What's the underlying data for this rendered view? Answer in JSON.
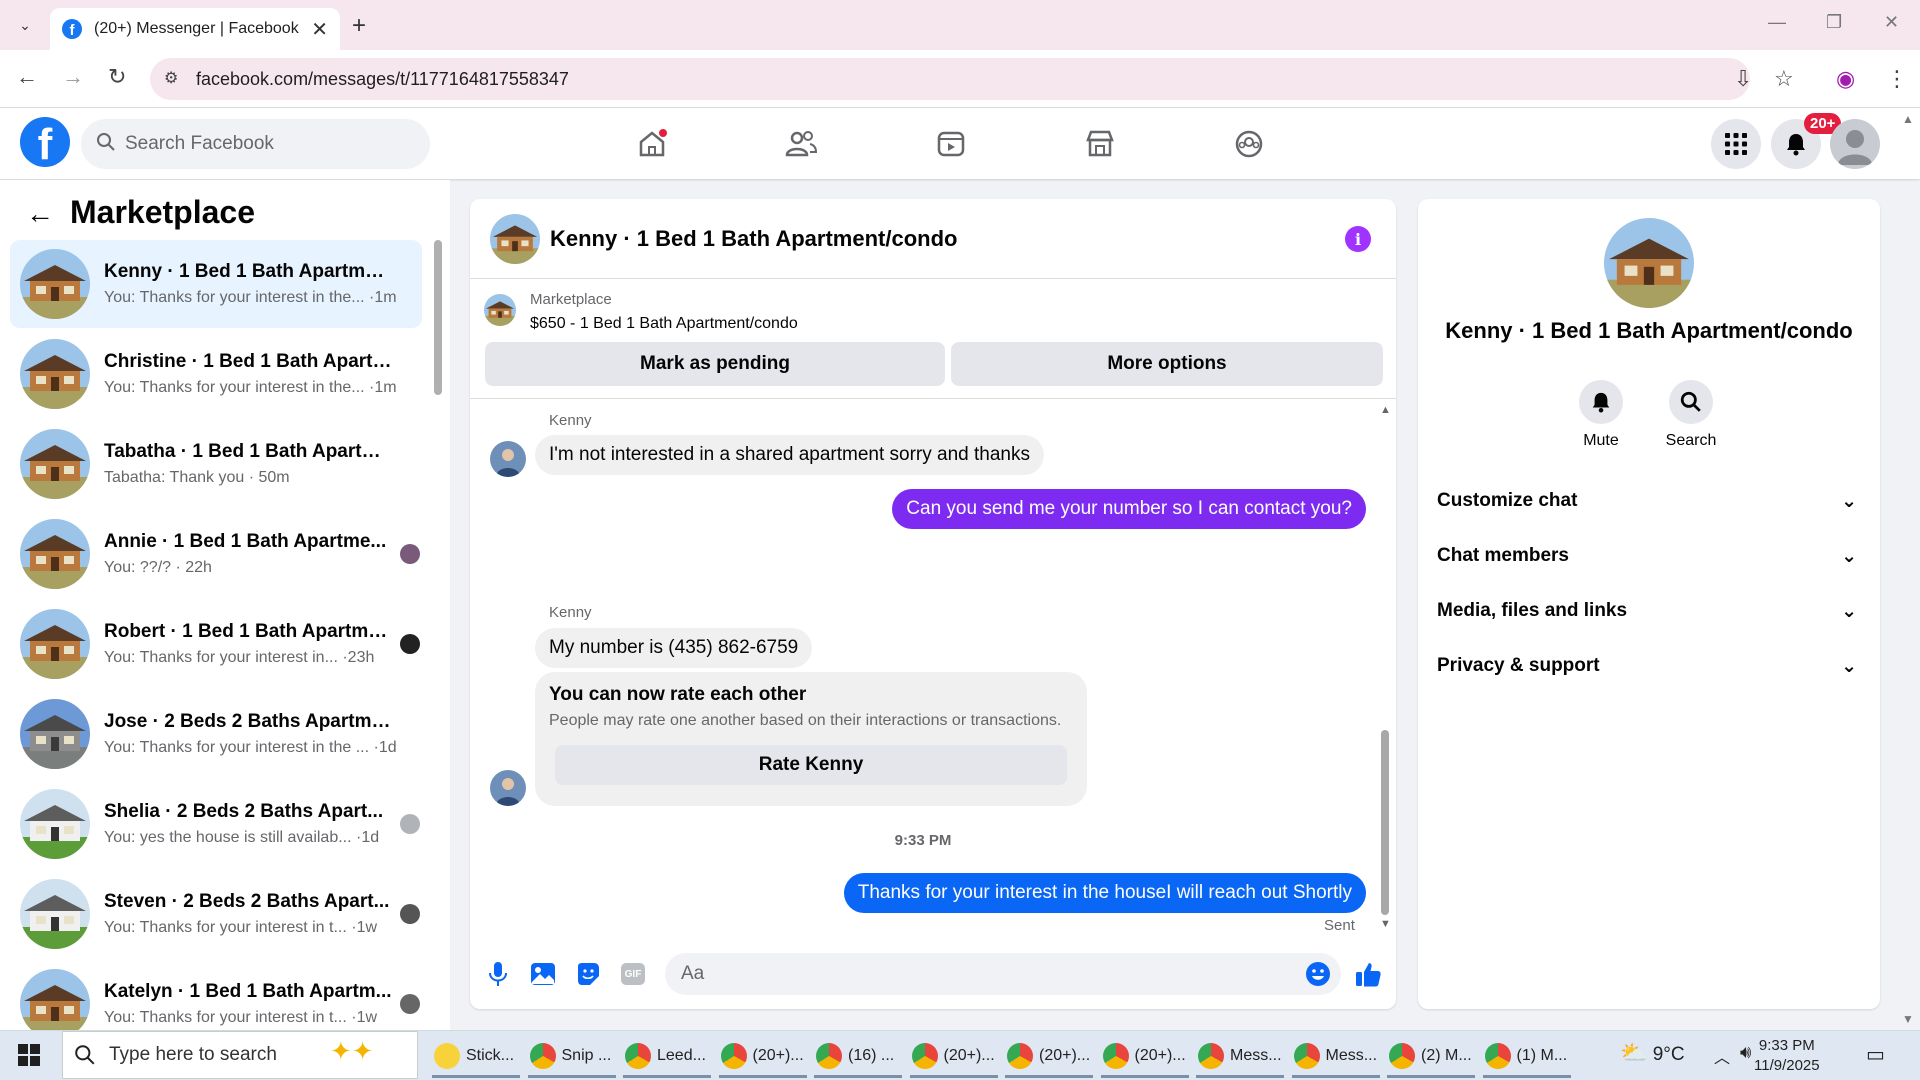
{
  "browser": {
    "tab_title": "(20+) Messenger | Facebook",
    "url": "facebook.com/messages/t/1177164817558347"
  },
  "fb": {
    "search_placeholder": "Search Facebook",
    "notif_badge": "20+"
  },
  "left": {
    "title": "Marketplace",
    "conversations": [
      {
        "name": "Kenny · 1 Bed 1 Bath Apartment/...",
        "preview": "You: Thanks for your interest in the... ·1m",
        "thumb": "house"
      },
      {
        "name": "Christine · 1 Bed 1 Bath Apartme...",
        "preview": "You: Thanks for your interest in the... ·1m",
        "thumb": "house"
      },
      {
        "name": "Tabatha · 1 Bed 1 Bath Apartmen...",
        "preview": "Tabatha: Thank you · 50m",
        "thumb": "house"
      },
      {
        "name": "Annie · 1 Bed 1 Bath Apartme...",
        "preview": "You: ??/? · 22h",
        "thumb": "house"
      },
      {
        "name": "Robert · 1 Bed 1 Bath Apartme...",
        "preview": "You: Thanks for your interest in... ·23h",
        "thumb": "house"
      },
      {
        "name": "Jose · 2 Beds 2 Baths Apartment...",
        "preview": "You: Thanks for your interest in the ... ·1d",
        "thumb": "gray-house"
      },
      {
        "name": "Shelia · 2 Beds 2 Baths Apart...",
        "preview": "You: yes the house is still availab... ·1d",
        "thumb": "green-house"
      },
      {
        "name": "Steven · 2 Beds 2 Baths Apart...",
        "preview": "You: Thanks for your interest in t... ·1w",
        "thumb": "green-house"
      },
      {
        "name": "Katelyn · 1 Bed 1 Bath Apartm...",
        "preview": "You: Thanks for your interest in t... ·1w",
        "thumb": "house"
      }
    ]
  },
  "chat": {
    "title": "Kenny · 1 Bed 1 Bath Apartment/condo",
    "marketplace_label": "Marketplace",
    "listing": "$650 - 1 Bed 1 Bath Apartment/condo",
    "btn_pending": "Mark as pending",
    "btn_more": "More options",
    "messages": {
      "sender1": "Kenny",
      "m1": "I'm not interested in a shared apartment sorry and thanks",
      "m2": "Can you send me your number so I can contact you?",
      "sender2": "Kenny",
      "m3": "My number is (435) 862-6759",
      "rate_title": "You can now rate each other",
      "rate_sub": "People may rate one another based on their interactions or transactions.",
      "rate_btn": "Rate Kenny",
      "time": "9:33 PM",
      "m4": "Thanks for your interest in the houseI will reach out Shortly",
      "status": "Sent"
    },
    "composer_placeholder": "Aa",
    "colors": {
      "out_bubble": "#7d2bf0",
      "out_bubble2": "#0a66f5",
      "accent": "#a033ff"
    }
  },
  "right": {
    "name": "Kenny · 1 Bed 1 Bath Apartment/condo",
    "mute": "Mute",
    "search": "Search",
    "sections": [
      "Customize chat",
      "Chat members",
      "Media, files and links",
      "Privacy & support"
    ]
  },
  "taskbar": {
    "search_placeholder": "Type here to search",
    "apps": [
      "Stick...",
      "Snip ...",
      "Leed...",
      "(20+)...",
      "(16) ...",
      "(20+)...",
      "(20+)...",
      "(20+)...",
      "Mess...",
      "Mess...",
      "(2) M...",
      "(1) M..."
    ],
    "weather": "9°C",
    "time": "9:33 PM",
    "date": "11/9/2025"
  }
}
